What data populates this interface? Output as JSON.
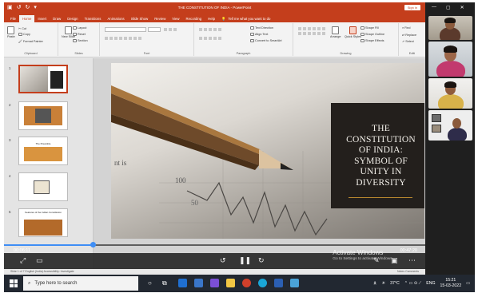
{
  "window": {
    "title": "THE CONSTITUTION OF INDIA - PowerPoint",
    "signin": "Sign in",
    "quick_access": [
      "↺",
      "↻",
      "▾"
    ]
  },
  "ribbon_tabs": [
    "File",
    "Home",
    "Insert",
    "Draw",
    "Design",
    "Transitions",
    "Animations",
    "Slide Show",
    "Review",
    "View",
    "Recording",
    "Help"
  ],
  "active_tab": "Home",
  "tell_me": "Tell me what you want to do",
  "ribbon": {
    "clipboard": {
      "paste": "Paste",
      "cut": "Cut",
      "copy": "Copy",
      "format_painter": "Format Painter",
      "label": "Clipboard"
    },
    "slides": {
      "new_slide": "New Slide",
      "layout": "Layout",
      "reset": "Reset",
      "section": "Section",
      "label": "Slides"
    },
    "font": {
      "label": "Font"
    },
    "paragraph": {
      "text_direction": "Text Direction",
      "align_text": "Align Text",
      "convert": "Convert to SmartArt",
      "label": "Paragraph"
    },
    "drawing": {
      "arrange": "Arrange",
      "quick_styles": "Quick Styles",
      "shape_fill": "Shape Fill",
      "shape_outline": "Shape Outline",
      "shape_effects": "Shape Effects",
      "label": "Drawing"
    },
    "editing": {
      "find": "Find",
      "replace": "Replace",
      "select": "Select",
      "label": "Editi"
    }
  },
  "thumbnails": [
    {
      "number": "1",
      "kind": "title"
    },
    {
      "number": "2",
      "kind": "orange-photo"
    },
    {
      "number": "3",
      "kind": "preamble",
      "text": "The Preamble"
    },
    {
      "number": "4",
      "kind": "document"
    },
    {
      "number": "5",
      "kind": "features",
      "text": "Features of the Indian Constitution"
    }
  ],
  "slide": {
    "title_lines": [
      "THE",
      "CONSTITUTION",
      "OF INDIA:",
      "SYMBOL OF",
      "UNITY IN",
      "DIVERSITY"
    ],
    "bg_numbers": [
      "100",
      "50"
    ],
    "bg_text": "nt is"
  },
  "video": {
    "elapsed": "00:06:11",
    "total": "00:47:20",
    "progress": 0.21,
    "activate_title": "Activate Windows",
    "activate_sub": "Go to Settings to activate Windows."
  },
  "status": {
    "left": "Slide 1 of 7   English (India)   Accessibility: Investigate",
    "right": "Notes   Comments"
  },
  "meet": {
    "controls": [
      "—",
      "▢",
      "✕"
    ]
  },
  "taskbar": {
    "search_placeholder": "Type here to search",
    "weather": "37°C",
    "language": "ENG",
    "time": "15:21",
    "date": "15-03-2022"
  },
  "colors": {
    "ppt_accent": "#c43e1c",
    "progress": "#3f8ef5",
    "slide_title_bg": "#231f1c",
    "accent_rule": "#b9892f"
  }
}
